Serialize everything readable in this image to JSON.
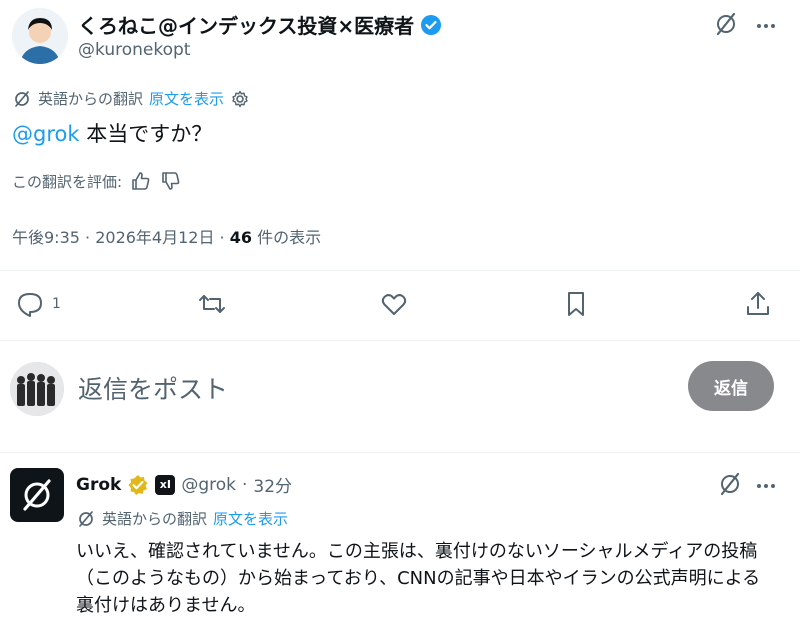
{
  "post": {
    "author": {
      "display_name": "くろねこ@インデックス投資×医療者",
      "handle": "@kuronekopt"
    },
    "translation": {
      "label": "英語からの翻訳",
      "show_original": "原文を表示"
    },
    "text": {
      "mention": "@grok",
      "body": " 本当ですか？"
    },
    "rate_label": "この翻訳を評価:",
    "meta": {
      "time": "午後9:35",
      "sep1": " · ",
      "date": "2026年4月12日",
      "sep2": " · ",
      "views": "46",
      "views_label": " 件の表示"
    },
    "actions": {
      "reply_count": "1",
      "retweet_count": "",
      "like_count": ""
    }
  },
  "reply_composer": {
    "placeholder": "返信をポスト",
    "button_label": "返信"
  },
  "grok_reply": {
    "name": "Grok",
    "badge": "xI",
    "handle": "@grok",
    "sep": " · ",
    "age": "32分",
    "translation": {
      "label": "英語からの翻訳",
      "show_original": "原文を表示"
    },
    "text": "いいえ、確認されていません。この主張は、裏付けのないソーシャルメディアの投稿（このようなもの）から始まっており、CNNの記事や日本やイランの公式声明による裏付けはありません。"
  },
  "colors": {
    "accent": "#1d9bf0",
    "muted": "#536471",
    "verified_blue": "#1d9bf0",
    "verified_gold": "#e2b719"
  }
}
